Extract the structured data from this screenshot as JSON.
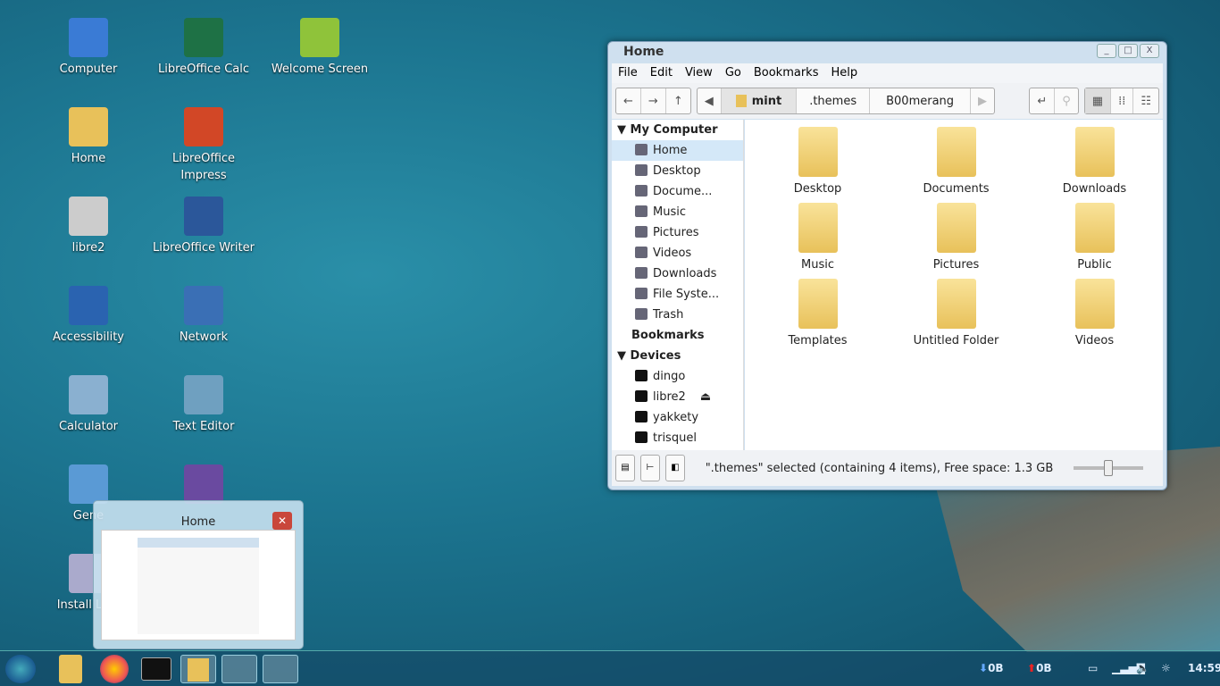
{
  "desktop": {
    "icons": [
      {
        "label": "Computer",
        "color": "#3a7bd5"
      },
      {
        "label": "LibreOffice Calc",
        "color": "#1e7145"
      },
      {
        "label": "Welcome Screen",
        "color": "#8fc33a"
      },
      {
        "label": "Home",
        "color": "#e8c15a"
      },
      {
        "label": "LibreOffice Impress",
        "color": "#d24726"
      },
      {
        "label": "libre2",
        "color": "#ccc"
      },
      {
        "label": "LibreOffice Writer",
        "color": "#2b579a"
      },
      {
        "label": "Accessibility",
        "color": "#2a63b0"
      },
      {
        "label": "Network",
        "color": "#3a6fb5"
      },
      {
        "label": "Calculator",
        "color": "#8ab0d0"
      },
      {
        "label": "Text Editor",
        "color": "#6fa0c0"
      },
      {
        "label": "Gene",
        "color": "#5a9ad5"
      },
      {
        "label": "",
        "color": "#6a4aa0"
      },
      {
        "label": "Install Linu",
        "color": "#aac"
      }
    ]
  },
  "window": {
    "title": "Home",
    "controls": [
      "_",
      "□",
      "X"
    ],
    "menu": [
      "File",
      "Edit",
      "View",
      "Go",
      "Bookmarks",
      "Help"
    ],
    "breadcrumb": [
      "mint",
      ".themes",
      "B00merang"
    ],
    "sidebar": {
      "my_computer": "My Computer",
      "places": [
        "Home",
        "Desktop",
        "Docume...",
        "Music",
        "Pictures",
        "Videos",
        "Downloads",
        "File Syste...",
        "Trash"
      ],
      "bookmarks": "Bookmarks",
      "devices_header": "Devices",
      "devices": [
        "dingo",
        "libre2",
        "yakkety",
        "trisquel"
      ],
      "selected": "Home"
    },
    "items": [
      "Desktop",
      "Documents",
      "Downloads",
      "Music",
      "Pictures",
      "Public",
      "Templates",
      "Untitled Folder",
      "Videos"
    ],
    "status": "\".themes\" selected (containing 4 items), Free space: 1.3 GB",
    "zoom_fraction": 0.5
  },
  "preview": {
    "title": "Home",
    "close": "✕"
  },
  "taskbar": {
    "net_down": "0B",
    "net_up": "0B",
    "clock": "14:59",
    "accent": "#1c7590"
  }
}
